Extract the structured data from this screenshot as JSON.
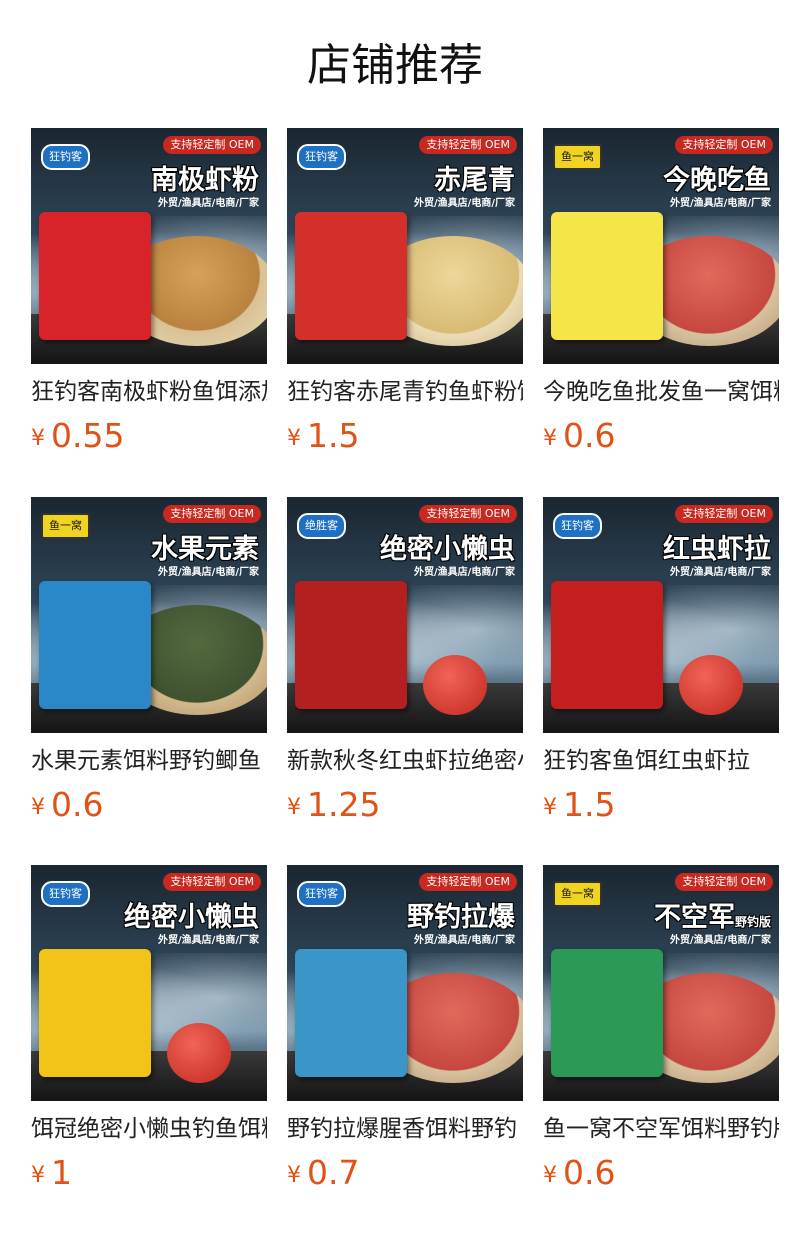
{
  "page_title": "店铺推荐",
  "badge_text": "支持轻定制 OEM",
  "sub_text": "外贸/渔具店/电商/厂家",
  "currency": "¥",
  "products": [
    {
      "brand": "狂钓客",
      "banner": "南极虾粉",
      "banner_suffix": "",
      "name": "狂钓客南极虾粉鱼饵添加剂",
      "price": "0.55",
      "bag_color": "#d8232a",
      "bowl": "brown"
    },
    {
      "brand": "狂钓客",
      "banner": "赤尾青",
      "banner_suffix": "",
      "name": "狂钓客赤尾青钓鱼虾粉饵料",
      "price": "1.5",
      "bag_color": "#d3302c",
      "bowl": "light"
    },
    {
      "brand": "鱼一窝",
      "banner": "今晚吃鱼",
      "banner_suffix": "",
      "name": "今晚吃鱼批发鱼一窝饵料",
      "price": "0.6",
      "bag_color": "#f4e548",
      "bowl": "red"
    },
    {
      "brand": "鱼一窝",
      "banner": "水果元素",
      "banner_suffix": "",
      "name": "水果元素饵料野钓鲫鱼",
      "price": "0.6",
      "bag_color": "#2a88c8",
      "bowl": "green"
    },
    {
      "brand": "绝胜客",
      "banner": "绝密小懒虫",
      "banner_suffix": "",
      "name": "新款秋冬红虫虾拉绝密小懒虫",
      "price": "1.25",
      "bag_color": "#b41f1f",
      "bowl": "ball"
    },
    {
      "brand": "狂钓客",
      "banner": "红虫虾拉",
      "banner_suffix": "",
      "name": "狂钓客鱼饵红虫虾拉",
      "price": "1.5",
      "bag_color": "#c41e1e",
      "bowl": "ball"
    },
    {
      "brand": "狂钓客",
      "banner": "绝密小懒虫",
      "banner_suffix": "",
      "name": "饵冠绝密小懒虫钓鱼饵料",
      "price": "1",
      "bag_color": "#f2c418",
      "bowl": "ball"
    },
    {
      "brand": "狂钓客",
      "banner": "野钓拉爆",
      "banner_suffix": "",
      "name": "野钓拉爆腥香饵料野钓",
      "price": "0.7",
      "bag_color": "#3a95c9",
      "bowl": "red"
    },
    {
      "brand": "鱼一窝",
      "banner": "不空军",
      "banner_suffix": "野钓版",
      "name": "鱼一窝不空军饵料野钓版",
      "price": "0.6",
      "bag_color": "#2c9a57",
      "bowl": "red"
    }
  ]
}
